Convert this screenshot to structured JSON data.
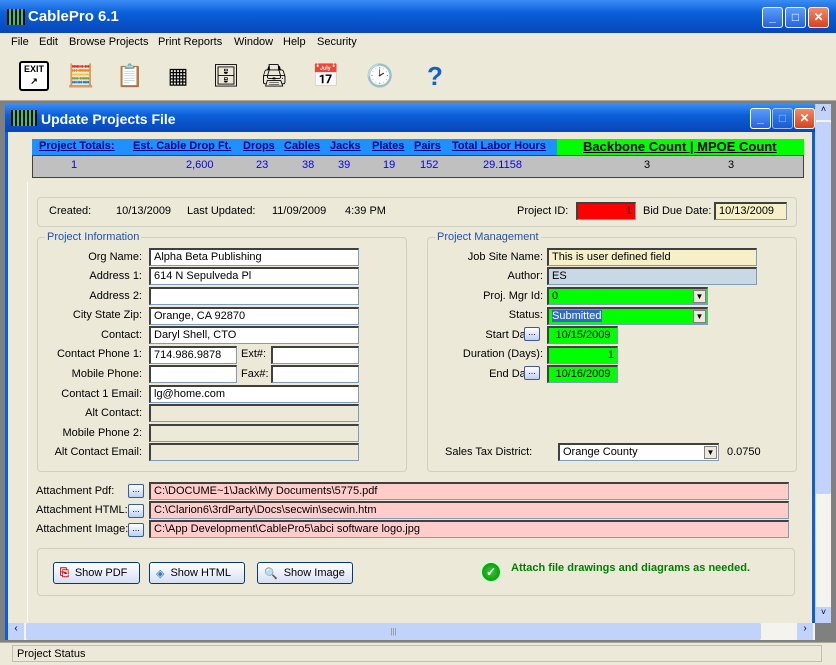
{
  "app": {
    "title": "CablePro 6.1"
  },
  "menu": [
    "File",
    "Edit",
    "Browse Projects",
    "Print Reports",
    "Window",
    "Help",
    "Security"
  ],
  "toolbar": [
    {
      "icon": "exit-icon"
    },
    {
      "icon": "calculator-edit-icon"
    },
    {
      "icon": "checklist-icon"
    },
    {
      "icon": "spreadsheet-icon"
    },
    {
      "icon": "file-cabinet-icon"
    },
    {
      "icon": "printer-icon"
    },
    {
      "icon": "calendar-icon"
    },
    {
      "icon": "schedule-clock-icon"
    },
    {
      "icon": "help-icon"
    }
  ],
  "child": {
    "title": "Update Projects File"
  },
  "totals": {
    "headers": [
      "Project Totals:",
      "Est. Cable Drop Ft.",
      "Drops",
      "Cables",
      "Jacks",
      "Plates",
      "Pairs",
      "Total Labor Hours"
    ],
    "values": [
      "1",
      "2,600",
      "23",
      "38",
      "39",
      "19",
      "152",
      "29.1158"
    ],
    "backbone_header": "Backbone Count | MPOE Count",
    "backbone": "3",
    "mpoe": "3"
  },
  "info": {
    "created_label": "Created:",
    "created": "10/13/2009",
    "updated_label": "Last Updated:",
    "updated": "11/09/2009",
    "time": "4:39 PM",
    "project_id_label": "Project ID:",
    "project_id": "1",
    "bid_due_label": "Bid Due Date:",
    "bid_due": "10/13/2009"
  },
  "project_info": {
    "title": "Project Information",
    "org_label": "Org Name:",
    "org": "Alpha Beta Publishing",
    "addr1_label": "Address 1:",
    "addr1": "614 N Sepulveda Pl",
    "addr2_label": "Address 2:",
    "addr2": "",
    "city_label": "City State Zip:",
    "city": "Orange, CA  92870",
    "contact_label": "Contact:",
    "contact": "Daryl Shell, CTO",
    "phone1_label": "Contact Phone 1:",
    "phone1": "714.986.9878",
    "ext_label": "Ext#:",
    "ext": "",
    "mobile_label": "Mobile Phone:",
    "mobile": "",
    "fax_label": "Fax#:",
    "fax": "",
    "email_label": "Contact 1 Email:",
    "email": "lg@home.com",
    "alt_contact_label": "Alt Contact:",
    "mobile2_label": "Mobile Phone 2:",
    "alt_email_label": "Alt Contact Email:"
  },
  "project_mgmt": {
    "title": "Project Management",
    "job_site_label": "Job Site Name:",
    "job_site": "This is user defined field",
    "author_label": "Author:",
    "author": "ES",
    "mgr_label": "Proj. Mgr Id:",
    "mgr": "0",
    "status_label": "Status:",
    "status": "Submitted",
    "start_label": "Start Date:",
    "start": "10/15/2009",
    "duration_label": "Duration (Days):",
    "duration": "1",
    "end_label": "End Date:",
    "end": "10/16/2009",
    "tax_label": "Sales Tax District:",
    "tax_district": "Orange County",
    "tax_rate": "0.0750"
  },
  "attachments": {
    "pdf_label": "Attachment Pdf:",
    "pdf": "C:\\DOCUME~1\\Jack\\My Documents\\5775.pdf",
    "html_label": "Attachment HTML:",
    "html": "C:\\Clarion6\\3rdParty\\Docs\\secwin\\secwin.htm",
    "image_label": "Attachment Image:",
    "image": "C:\\App Development\\CablePro5\\abci software logo.jpg",
    "ellipsis": "..."
  },
  "buttons": {
    "show_pdf": "Show PDF",
    "show_html": "Show HTML",
    "show_image": "Show Image"
  },
  "hint": "Attach file drawings and diagrams as needed.",
  "status_bar": "Project Status",
  "colors": {
    "accent_blue": "#0a5fd8",
    "totals_blue": "#1e90ff",
    "green": "#00ff00",
    "red": "#ff0000",
    "attachment_pink": "#ffcccc",
    "hint_green": "#008000"
  }
}
